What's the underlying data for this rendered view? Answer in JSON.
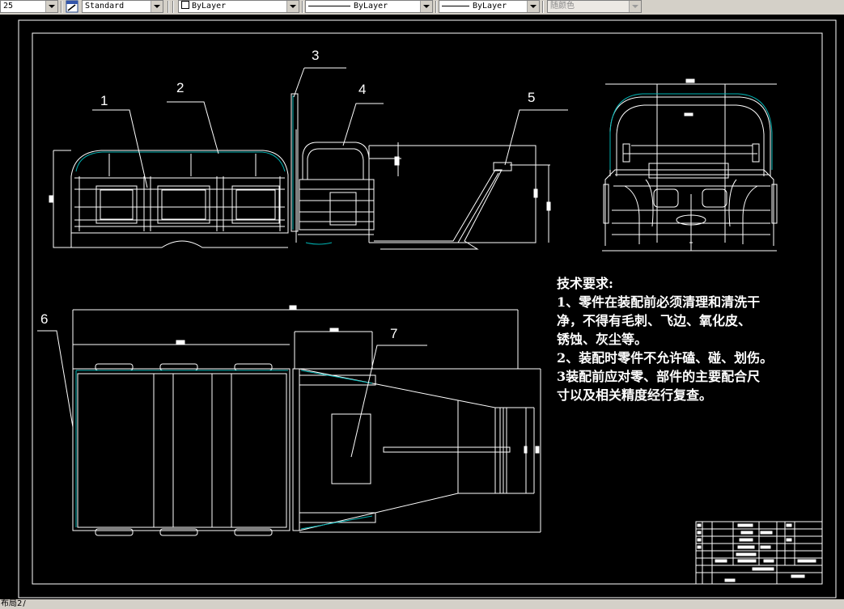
{
  "toolbar": {
    "scale_value": "25",
    "text_style": "Standard",
    "layer_value": "ByLayer",
    "linetype_value": "ByLayer",
    "lineweight_value": "ByLayer",
    "plotstyle_value": "随颜色"
  },
  "drawing": {
    "callouts": [
      "1",
      "2",
      "3",
      "4",
      "5",
      "6",
      "7"
    ],
    "notes_title": "技术要求:",
    "notes": [
      "1、零件在装配前必须清理和清洗干",
      "净，不得有毛刺、飞边、氧化皮、",
      "锈蚀、灰尘等。",
      "2、装配时零件不允许磕、碰、划伤。",
      "3装配前应对零、部件的主要配合尺",
      "寸以及相关精度经行复查。"
    ]
  },
  "status": {
    "layout_tab": "布局2"
  },
  "colors": {
    "background": "#000000",
    "lines": "#ffffff",
    "accent": "#00b4b4",
    "toolbar": "#d4d0c8"
  }
}
